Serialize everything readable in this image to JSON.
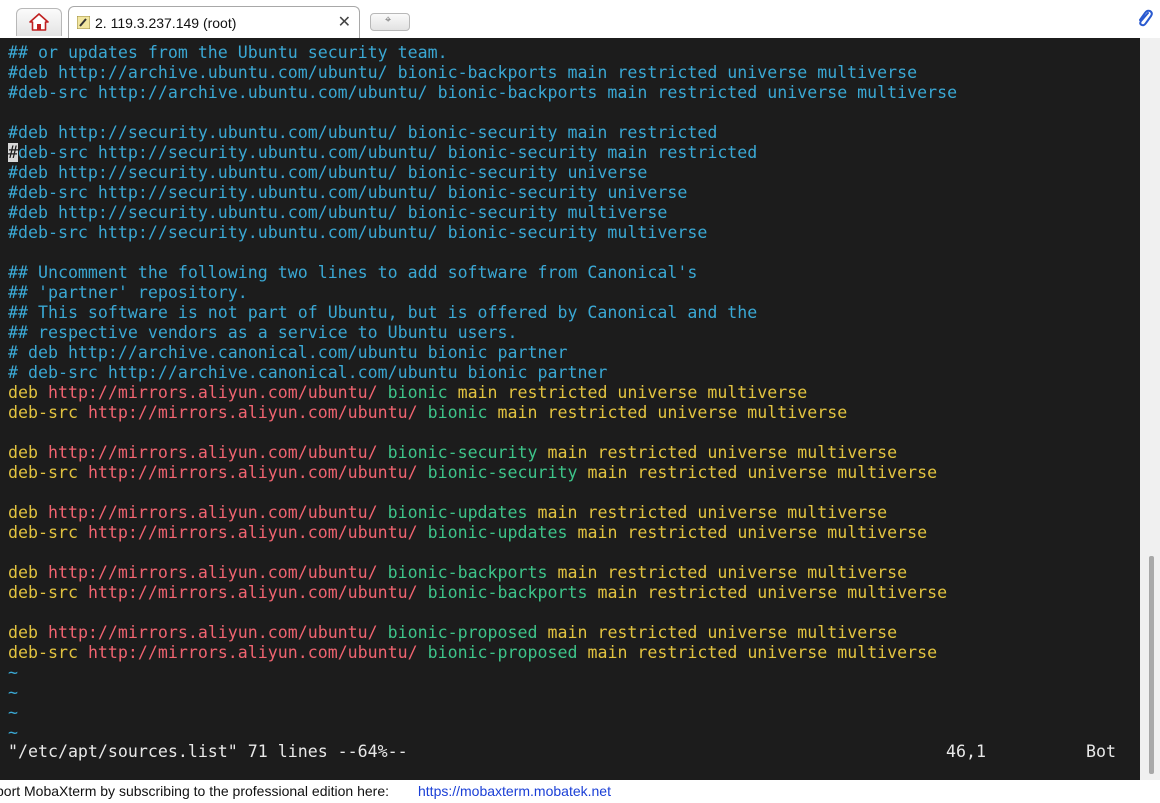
{
  "tabs": {
    "home_icon": "home-icon",
    "session_label": "2. 119.3.237.149 (root)",
    "close_label": "✕",
    "new_tab_label": "⌖"
  },
  "terminal": {
    "lines": [
      {
        "segments": [
          {
            "text": "## or updates from the Ubuntu security team.",
            "cls": "c-comment"
          }
        ]
      },
      {
        "segments": [
          {
            "text": "#deb http://archive.ubuntu.com/ubuntu/ bionic-backports main restricted universe multiverse",
            "cls": "c-comment"
          }
        ]
      },
      {
        "segments": [
          {
            "text": "#deb-src http://archive.ubuntu.com/ubuntu/ bionic-backports main restricted universe multiverse",
            "cls": "c-comment"
          }
        ]
      },
      {
        "segments": [
          {
            "text": "",
            "cls": "c-comment"
          }
        ]
      },
      {
        "segments": [
          {
            "text": "#deb http://security.ubuntu.com/ubuntu/ bionic-security main restricted",
            "cls": "c-comment"
          }
        ]
      },
      {
        "segments": [
          {
            "text": "#",
            "cls": "cursor-char"
          },
          {
            "text": "deb-src http://security.ubuntu.com/ubuntu/ bionic-security main restricted",
            "cls": "c-comment"
          }
        ]
      },
      {
        "segments": [
          {
            "text": "#deb http://security.ubuntu.com/ubuntu/ bionic-security universe",
            "cls": "c-comment"
          }
        ]
      },
      {
        "segments": [
          {
            "text": "#deb-src http://security.ubuntu.com/ubuntu/ bionic-security universe",
            "cls": "c-comment"
          }
        ]
      },
      {
        "segments": [
          {
            "text": "#deb http://security.ubuntu.com/ubuntu/ bionic-security multiverse",
            "cls": "c-comment"
          }
        ]
      },
      {
        "segments": [
          {
            "text": "#deb-src http://security.ubuntu.com/ubuntu/ bionic-security multiverse",
            "cls": "c-comment"
          }
        ]
      },
      {
        "segments": [
          {
            "text": "",
            "cls": "c-comment"
          }
        ]
      },
      {
        "segments": [
          {
            "text": "## Uncomment the following two lines to add software from Canonical's",
            "cls": "c-comment"
          }
        ]
      },
      {
        "segments": [
          {
            "text": "## 'partner' repository.",
            "cls": "c-comment"
          }
        ]
      },
      {
        "segments": [
          {
            "text": "## This software is not part of Ubuntu, but is offered by Canonical and the",
            "cls": "c-comment"
          }
        ]
      },
      {
        "segments": [
          {
            "text": "## respective vendors as a service to Ubuntu users.",
            "cls": "c-comment"
          }
        ]
      },
      {
        "segments": [
          {
            "text": "# deb http://archive.canonical.com/ubuntu bionic partner",
            "cls": "c-comment"
          }
        ]
      },
      {
        "segments": [
          {
            "text": "# deb-src http://archive.canonical.com/ubuntu bionic partner",
            "cls": "c-comment"
          }
        ]
      },
      {
        "segments": [
          {
            "text": "deb ",
            "cls": "c-deb"
          },
          {
            "text": "http://mirrors.aliyun.com/ubuntu/ ",
            "cls": "c-url"
          },
          {
            "text": "bionic ",
            "cls": "c-suite"
          },
          {
            "text": "main restricted universe multiverse",
            "cls": "c-comp"
          }
        ]
      },
      {
        "segments": [
          {
            "text": "deb-src ",
            "cls": "c-deb"
          },
          {
            "text": "http://mirrors.aliyun.com/ubuntu/ ",
            "cls": "c-url"
          },
          {
            "text": "bionic ",
            "cls": "c-suite"
          },
          {
            "text": "main restricted universe multiverse",
            "cls": "c-comp"
          }
        ]
      },
      {
        "segments": [
          {
            "text": "",
            "cls": "c-comp"
          }
        ]
      },
      {
        "segments": [
          {
            "text": "deb ",
            "cls": "c-deb"
          },
          {
            "text": "http://mirrors.aliyun.com/ubuntu/ ",
            "cls": "c-url"
          },
          {
            "text": "bionic-security ",
            "cls": "c-suite"
          },
          {
            "text": "main restricted universe multiverse",
            "cls": "c-comp"
          }
        ]
      },
      {
        "segments": [
          {
            "text": "deb-src ",
            "cls": "c-deb"
          },
          {
            "text": "http://mirrors.aliyun.com/ubuntu/ ",
            "cls": "c-url"
          },
          {
            "text": "bionic-security ",
            "cls": "c-suite"
          },
          {
            "text": "main restricted universe multiverse",
            "cls": "c-comp"
          }
        ]
      },
      {
        "segments": [
          {
            "text": "",
            "cls": "c-comp"
          }
        ]
      },
      {
        "segments": [
          {
            "text": "deb ",
            "cls": "c-deb"
          },
          {
            "text": "http://mirrors.aliyun.com/ubuntu/ ",
            "cls": "c-url"
          },
          {
            "text": "bionic-updates ",
            "cls": "c-suite"
          },
          {
            "text": "main restricted universe multiverse",
            "cls": "c-comp"
          }
        ]
      },
      {
        "segments": [
          {
            "text": "deb-src ",
            "cls": "c-deb"
          },
          {
            "text": "http://mirrors.aliyun.com/ubuntu/ ",
            "cls": "c-url"
          },
          {
            "text": "bionic-updates ",
            "cls": "c-suite"
          },
          {
            "text": "main restricted universe multiverse",
            "cls": "c-comp"
          }
        ]
      },
      {
        "segments": [
          {
            "text": "",
            "cls": "c-comp"
          }
        ]
      },
      {
        "segments": [
          {
            "text": "deb ",
            "cls": "c-deb"
          },
          {
            "text": "http://mirrors.aliyun.com/ubuntu/ ",
            "cls": "c-url"
          },
          {
            "text": "bionic-backports ",
            "cls": "c-suite"
          },
          {
            "text": "main restricted universe multiverse",
            "cls": "c-comp"
          }
        ]
      },
      {
        "segments": [
          {
            "text": "deb-src ",
            "cls": "c-deb"
          },
          {
            "text": "http://mirrors.aliyun.com/ubuntu/ ",
            "cls": "c-url"
          },
          {
            "text": "bionic-backports ",
            "cls": "c-suite"
          },
          {
            "text": "main restricted universe multiverse",
            "cls": "c-comp"
          }
        ]
      },
      {
        "segments": [
          {
            "text": "",
            "cls": "c-comp"
          }
        ]
      },
      {
        "segments": [
          {
            "text": "deb ",
            "cls": "c-deb"
          },
          {
            "text": "http://mirrors.aliyun.com/ubuntu/ ",
            "cls": "c-url"
          },
          {
            "text": "bionic-proposed ",
            "cls": "c-suite"
          },
          {
            "text": "main restricted universe multiverse",
            "cls": "c-comp"
          }
        ]
      },
      {
        "segments": [
          {
            "text": "deb-src ",
            "cls": "c-deb"
          },
          {
            "text": "http://mirrors.aliyun.com/ubuntu/ ",
            "cls": "c-url"
          },
          {
            "text": "bionic-proposed ",
            "cls": "c-suite"
          },
          {
            "text": "main restricted universe multiverse",
            "cls": "c-comp"
          }
        ]
      },
      {
        "segments": [
          {
            "text": "~",
            "cls": "c-tilde"
          }
        ]
      },
      {
        "segments": [
          {
            "text": "~",
            "cls": "c-tilde"
          }
        ]
      },
      {
        "segments": [
          {
            "text": "~",
            "cls": "c-tilde"
          }
        ]
      },
      {
        "segments": [
          {
            "text": "~",
            "cls": "c-tilde"
          }
        ]
      }
    ],
    "status": {
      "file_info": "\"/etc/apt/sources.list\" 71 lines --64%--",
      "position": "46,1",
      "scroll": "Bot"
    }
  },
  "footer": {
    "text": "port MobaXterm by subscribing to the professional edition here:",
    "link": "https://mobaxterm.mobatek.net"
  },
  "colors": {
    "terminal_bg": "#1c1c1c",
    "comment": "#3aa8d4",
    "keyword": "#e2c340",
    "url": "#f06470",
    "suite": "#3dc48a"
  }
}
